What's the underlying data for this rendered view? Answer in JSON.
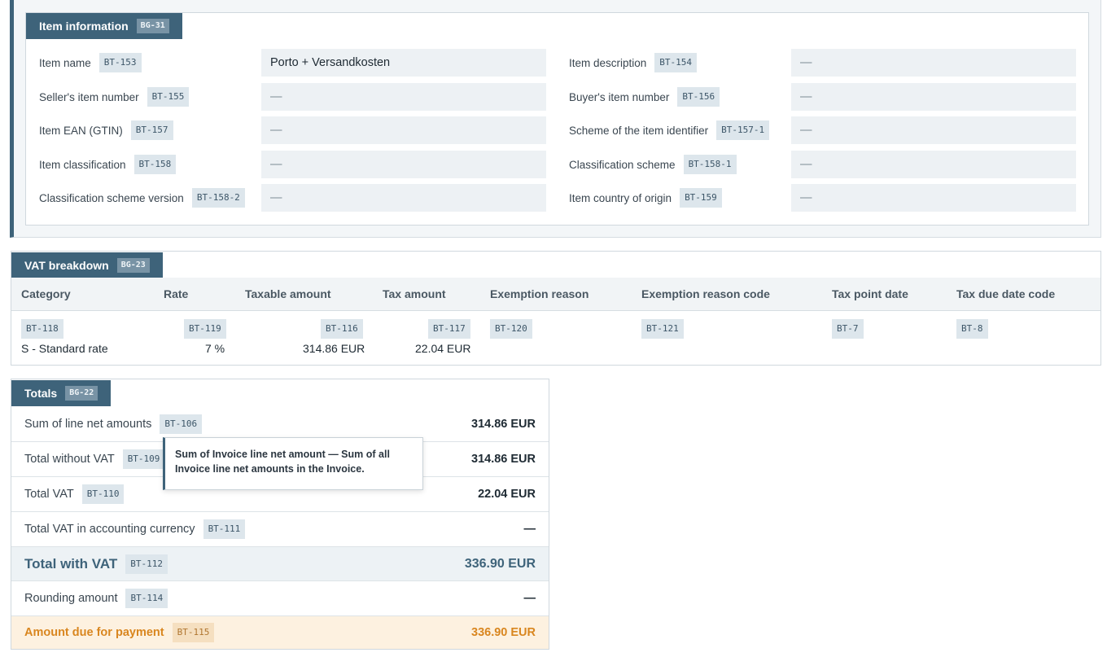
{
  "item_info": {
    "title": "Item information",
    "tag": "BG-31",
    "fields": [
      {
        "label": "Item name",
        "tag": "BT-153",
        "value": "Porto + Versandkosten"
      },
      {
        "label": "Item description",
        "tag": "BT-154",
        "value": "—"
      },
      {
        "label": "Seller's item number",
        "tag": "BT-155",
        "value": "—"
      },
      {
        "label": "Buyer's item number",
        "tag": "BT-156",
        "value": "—"
      },
      {
        "label": "Item EAN (GTIN)",
        "tag": "BT-157",
        "value": "—"
      },
      {
        "label": "Scheme of the item identifier",
        "tag": "BT-157-1",
        "value": "—"
      },
      {
        "label": "Item classification",
        "tag": "BT-158",
        "value": "—"
      },
      {
        "label": "Classification scheme",
        "tag": "BT-158-1",
        "value": "—"
      },
      {
        "label": "Classification scheme version",
        "tag": "BT-158-2",
        "value": "—"
      },
      {
        "label": "Item country of origin",
        "tag": "BT-159",
        "value": "—"
      }
    ]
  },
  "vat_breakdown": {
    "title": "VAT breakdown",
    "tag": "BG-23",
    "columns": [
      {
        "header": "Category",
        "tag": "BT-118",
        "value": "S - Standard rate"
      },
      {
        "header": "Rate",
        "tag": "BT-119",
        "value": "7 %"
      },
      {
        "header": "Taxable amount",
        "tag": "BT-116",
        "value": "314.86 EUR"
      },
      {
        "header": "Tax amount",
        "tag": "BT-117",
        "value": "22.04 EUR"
      },
      {
        "header": "Exemption reason",
        "tag": "BT-120",
        "value": ""
      },
      {
        "header": "Exemption reason code",
        "tag": "BT-121",
        "value": ""
      },
      {
        "header": "Tax point date",
        "tag": "BT-7",
        "value": ""
      },
      {
        "header": "Tax due date code",
        "tag": "BT-8",
        "value": ""
      }
    ]
  },
  "totals": {
    "title": "Totals",
    "tag": "BG-22",
    "rows": [
      {
        "label": "Sum of line net amounts",
        "tag": "BT-106",
        "value": "314.86 EUR"
      },
      {
        "label": "Total without VAT",
        "tag": "BT-109",
        "value": "314.86 EUR"
      },
      {
        "label": "Total VAT",
        "tag": "BT-110",
        "value": "22.04 EUR"
      },
      {
        "label": "Total VAT in accounting currency",
        "tag": "BT-111",
        "value": "—"
      },
      {
        "label": "Total with VAT",
        "tag": "BT-112",
        "value": "336.90 EUR"
      },
      {
        "label": "Rounding amount",
        "tag": "BT-114",
        "value": "—"
      },
      {
        "label": "Amount due for payment",
        "tag": "BT-115",
        "value": "336.90 EUR"
      }
    ]
  },
  "tooltip": {
    "text": "Sum of Invoice line net amount — Sum of all Invoice line net amounts in the Invoice."
  },
  "colors": {
    "accent": "#3e637a",
    "due": "#d9861f",
    "tag_bg": "#dde6ec"
  }
}
